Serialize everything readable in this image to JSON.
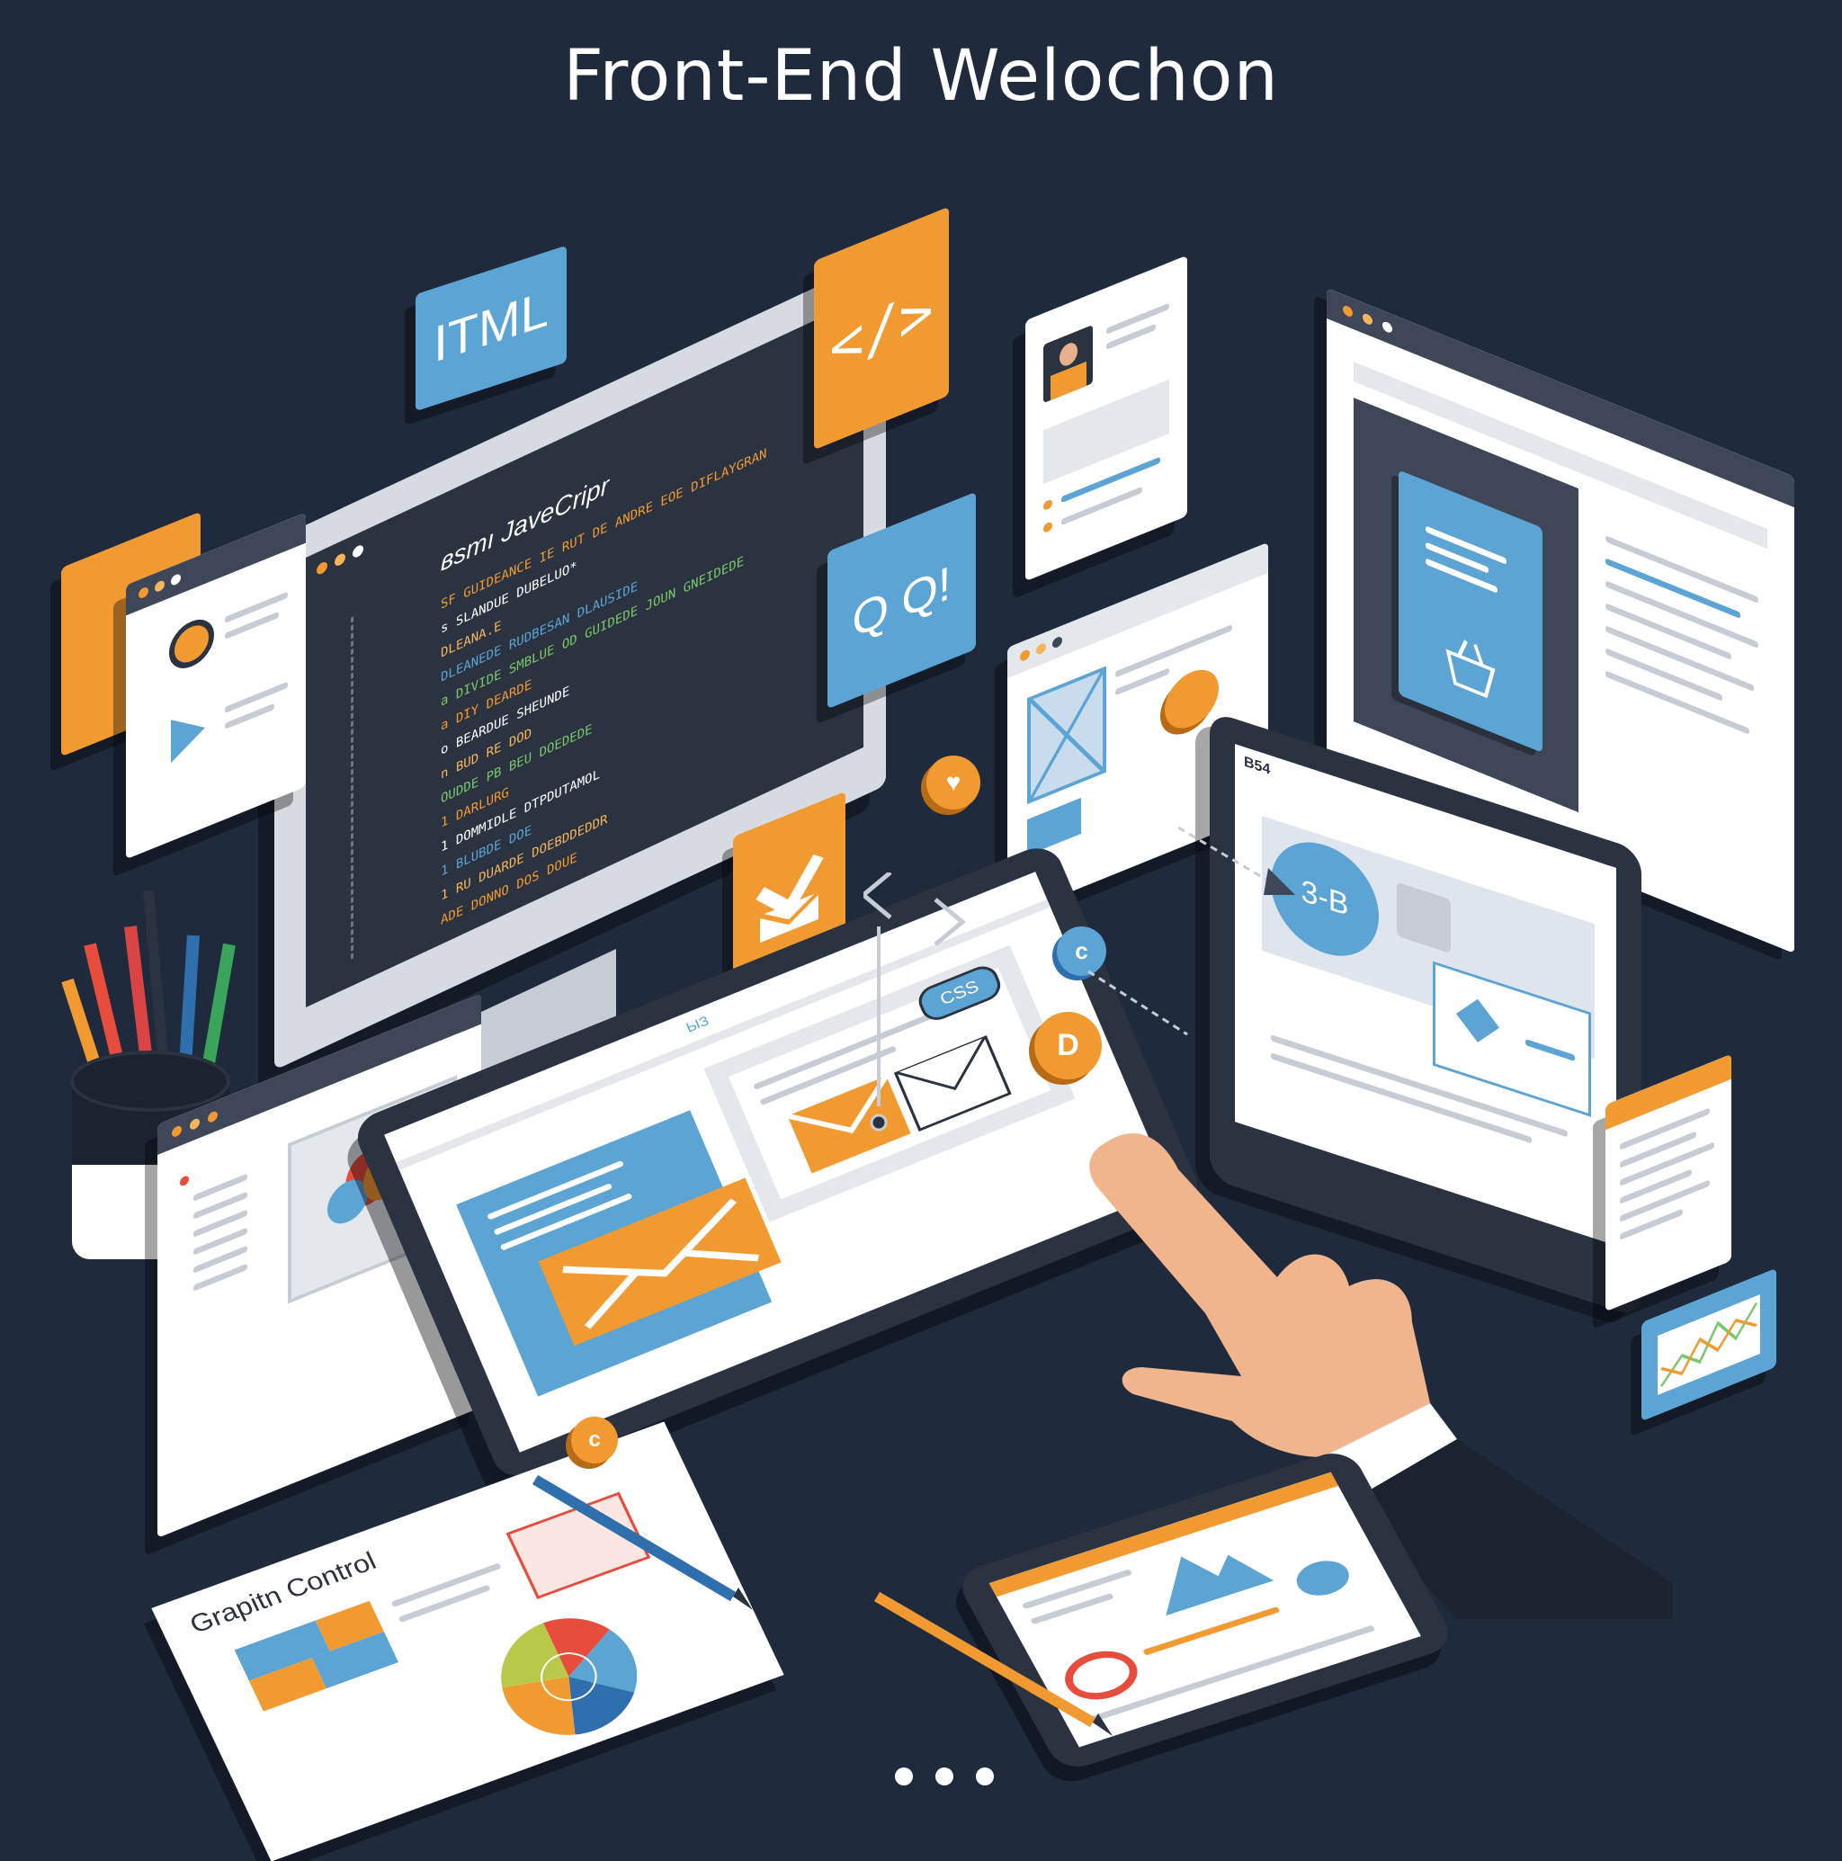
{
  "header": {
    "title": "Front-End Welochon"
  },
  "monitor": {
    "code_heading": "ʙsmı JaveCripr",
    "code_lines": [
      "SF GUIDEANCE IE RUT DE ANDRE EOE DIFLAYGRAN",
      "s SLANDUE DUBELUO*",
      "DLEANA.E",
      "DLEANEDE RUDBESAN DLAUSIDE",
      "a DIVIDE SMBLUE OD GUIDEDE JOUN GNEIDEDE",
      "a DIY DEARDE",
      "o BEARDUE SHEUNDE",
      "n BUD RE DOD",
      "OUDDE PB BEU DOEDEDE",
      "1 DARLURG",
      "1 DOMMIDLE DTPDUTAMOL",
      "1 BLUBDE DOE",
      "1 RU DUARDE DOEBDDEDDR",
      "ADE DONNO DOS DOUE"
    ]
  },
  "badges": {
    "html_label": "ITML",
    "code_tag": "</>",
    "search_label": "Q Q!"
  },
  "tablet_right": {
    "corner_label": "B54",
    "avatar_label": "3-B"
  },
  "tablet_center": {
    "tag_label": "CSS",
    "small_label": "ЫЗ"
  },
  "report": {
    "title": "Grapitn Control"
  },
  "coins": {
    "c1": "c",
    "c2": "D",
    "c3": "c"
  },
  "pagination": {
    "dots": 3
  },
  "colors": {
    "background": "#1f2a3c",
    "orange": "#f29a32",
    "blue": "#5ba4d4",
    "dark_panel": "#3d4758",
    "white": "#ffffff"
  }
}
